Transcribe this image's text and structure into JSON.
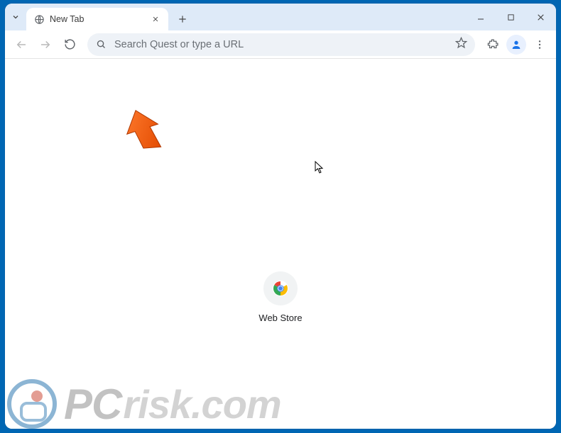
{
  "tab": {
    "title": "New Tab"
  },
  "omnibox": {
    "placeholder": "Search Quest or type a URL"
  },
  "shortcut": {
    "label": "Web Store"
  },
  "watermark": {
    "pc": "PC",
    "risk": "risk.com"
  }
}
